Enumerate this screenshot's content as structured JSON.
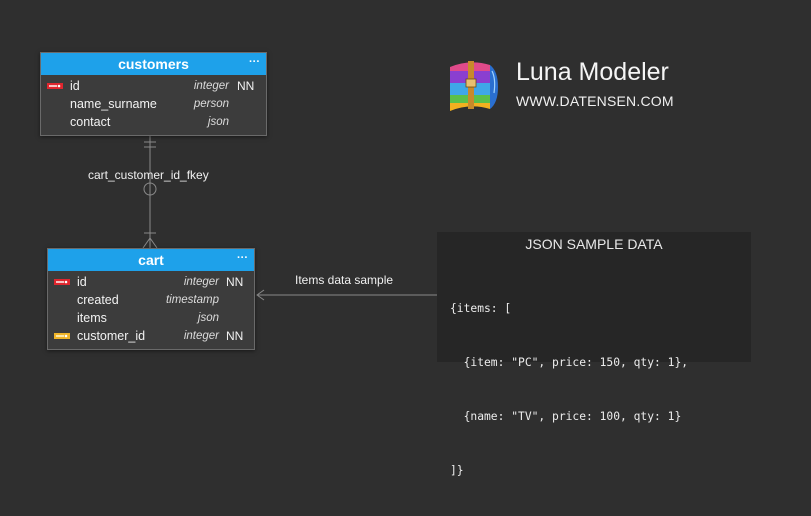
{
  "tables": {
    "customers": {
      "name": "customers",
      "menu": "···",
      "columns": [
        {
          "name": "id",
          "type": "integer",
          "nn": "NN",
          "key": "primary"
        },
        {
          "name": "name_surname",
          "type": "person",
          "nn": "",
          "key": ""
        },
        {
          "name": "contact",
          "type": "json",
          "nn": "",
          "key": ""
        }
      ]
    },
    "cart": {
      "name": "cart",
      "menu": "···",
      "columns": [
        {
          "name": "id",
          "type": "integer",
          "nn": "NN",
          "key": "primary"
        },
        {
          "name": "created",
          "type": "timestamp",
          "nn": "",
          "key": ""
        },
        {
          "name": "items",
          "type": "json",
          "nn": "",
          "key": ""
        },
        {
          "name": "customer_id",
          "type": "integer",
          "nn": "NN",
          "key": "foreign"
        }
      ]
    }
  },
  "relationship": {
    "label": "cart_customer_id_fkey",
    "from": "customers",
    "to": "cart"
  },
  "note_link": {
    "label": "Items data sample"
  },
  "brand": {
    "title": "Luna Modeler",
    "url": "WWW.DATENSEN.COM"
  },
  "json_note": {
    "title": "JSON SAMPLE DATA",
    "lines": [
      "{items: [",
      "  {item: \"PC\", price: 150, qty: 1},",
      "  {name: \"TV\", price: 100, qty: 1}",
      "]}"
    ]
  },
  "colors": {
    "background": "#2f2f2f",
    "header": "#1ea1ea",
    "primary_key": "#e0262e",
    "foreign_key": "#f0b428",
    "line": "#8a8a8a"
  }
}
